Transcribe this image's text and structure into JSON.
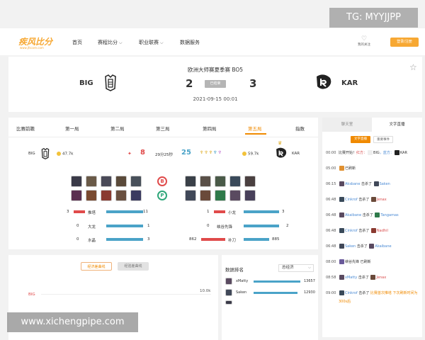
{
  "watermark_top": "TG: MYYJJPP",
  "watermark_bottom": "www.xichengpipe.com",
  "nav": {
    "logo": "疾风比分",
    "logo_sub": "www.jfscore.com",
    "items": [
      "首页",
      "赛程比分",
      "职业联赛",
      "数据服务"
    ],
    "follow": "我的关注",
    "login": "登录/注册"
  },
  "match": {
    "league": "欧洲大师赛夏季赛 BO5",
    "team_left": "BIG",
    "team_right": "KAR",
    "score_left": "2",
    "score_right": "3",
    "status": "已结束",
    "time": "2021-09-15 00:01"
  },
  "tabs": [
    "比赛前瞻",
    "第一局",
    "第二局",
    "第三局",
    "第四局",
    "第五局",
    "指数"
  ],
  "game": {
    "left_team": "BIG",
    "left_gold": "47.7k",
    "left_kills": "8",
    "duration": "29分25秒",
    "right_kills": "25",
    "right_gold": "59.7k",
    "right_team": "KAR",
    "side_blue": "B",
    "side_purple": "P"
  },
  "objectives": [
    {
      "left": "3",
      "label_l": "推塔",
      "right_l": "11",
      "right_r_left": "1",
      "label_r": "小龙",
      "right_r": "3"
    },
    {
      "left": "0",
      "label_l": "大龙",
      "right_l": "1",
      "right_r_left": "0",
      "label_r": "峡谷先锋",
      "right_r": "2"
    },
    {
      "left": "0",
      "label_l": "水晶",
      "right_l": "3",
      "right_r_left": "862",
      "label_r": "补刀",
      "right_r": "885"
    }
  ],
  "chart_panel": {
    "btn_active": "经济差曲线",
    "btn_inactive": "经验差曲线",
    "series_label": "BIG",
    "y_tick": "10.0k"
  },
  "ranking": {
    "title": "数据排名",
    "select": "总经济",
    "rows": [
      {
        "name": "xMatty",
        "value": "13657"
      },
      {
        "name": "Saken",
        "value": "12930"
      }
    ]
  },
  "live": {
    "tabs": [
      "聊天室",
      "文字直播"
    ],
    "subtabs": [
      "文字直播",
      "重要事件"
    ],
    "events": [
      {
        "t": "00:00",
        "parts": [
          "比赛开始！",
          "红方：",
          "BIG",
          "，蓝方：",
          "KAR"
        ]
      },
      {
        "t": "05:00",
        "parts": [
          "",
          "",
          "已刷新",
          "",
          ""
        ]
      },
      {
        "t": "06:15",
        "parts": [
          "Aksbane",
          "击杀了",
          "Saken",
          "",
          ""
        ]
      },
      {
        "t": "06:48",
        "parts": [
          "Cinkrof",
          "击杀了",
          "Jenax",
          "",
          ""
        ]
      },
      {
        "t": "06:48",
        "parts": [
          "Akaibane",
          "击杀了",
          "Tangamas",
          "",
          ""
        ]
      },
      {
        "t": "06:48",
        "parts": [
          "Cinkrof",
          "击杀了",
          "Nadhil",
          "",
          ""
        ]
      },
      {
        "t": "06:48",
        "parts": [
          "Saken",
          "击杀了",
          "Akaibane",
          "",
          ""
        ]
      },
      {
        "t": "08:00",
        "parts": [
          "峡谷先锋",
          "已刷新",
          "",
          "",
          ""
        ]
      },
      {
        "t": "08:58",
        "parts": [
          "xMatty",
          "击杀了",
          "Jenax",
          "",
          ""
        ]
      },
      {
        "t": "09:00",
        "parts": [
          "Cinkrof",
          "击杀了",
          "比赛首次推塔",
          "下次刷新时间为",
          "300s后"
        ]
      }
    ]
  },
  "colors": {
    "accent": "#f08a00",
    "red": "#e04a4a",
    "blue": "#4aa3c8"
  }
}
